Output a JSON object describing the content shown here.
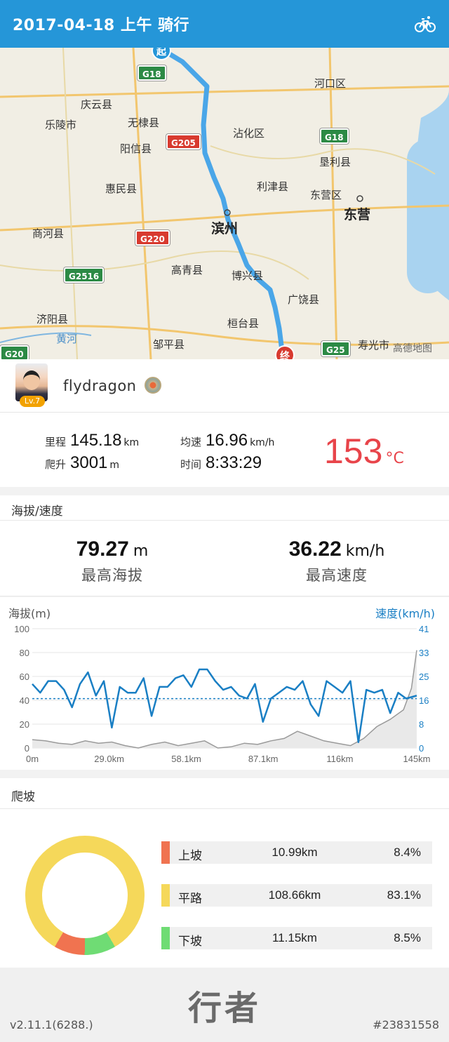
{
  "header": {
    "title": "2017-04-18 上午  骑行",
    "icon": "bicycle-icon"
  },
  "map": {
    "labels": [
      "河口区",
      "庆云县",
      "乐陵市",
      "无棣县",
      "沾化区",
      "阳信县",
      "垦利县",
      "惠民县",
      "利津县",
      "东营区",
      "东营",
      "滨州",
      "商河县",
      "高青县",
      "博兴县",
      "广饶县",
      "济阳县",
      "桓台县",
      "黄河",
      "邹平县",
      "寿光市",
      "高德地图",
      "起",
      "终"
    ],
    "shields": [
      "G18",
      "G205",
      "G18",
      "G220",
      "G2516",
      "G25",
      "G20"
    ]
  },
  "user": {
    "name": "flydragon",
    "level": "Lv.7"
  },
  "stats": {
    "distance": {
      "label": "里程",
      "value": "145.18",
      "unit": "km"
    },
    "avg_speed": {
      "label": "均速",
      "value": "16.96",
      "unit": "km/h"
    },
    "climb": {
      "label": "爬升",
      "value": "3001",
      "unit": "m"
    },
    "time": {
      "label": "时间",
      "value": "8:33:29"
    },
    "temperature": {
      "value": "153",
      "unit": "°C"
    }
  },
  "elevation_section": {
    "title": "海拔/速度"
  },
  "maxes": {
    "max_alt": {
      "value": "79.27",
      "unit": "m",
      "label": "最高海拔"
    },
    "max_speed": {
      "value": "36.22",
      "unit": "km/h",
      "label": "最高速度"
    }
  },
  "chart_data": {
    "type": "line",
    "left_axis_title": "海拔(m)",
    "right_axis_title": "速度(km/h)",
    "left_ticks": [
      "100",
      "80",
      "60",
      "40",
      "20",
      "0"
    ],
    "right_ticks": [
      "41",
      "33",
      "25",
      "16",
      "8",
      "0"
    ],
    "x_ticks": [
      "0m",
      "29.0km",
      "58.1km",
      "87.1km",
      "116km",
      "145km"
    ],
    "ylim_left": [
      0,
      100
    ],
    "ylim_right": [
      0,
      41
    ],
    "xlim": [
      0,
      145
    ],
    "avg_speed_line": 16.96,
    "colors": {
      "speed": "#1a7fc4",
      "altitude": "#9a9a9a",
      "avg": "#1a7fc4"
    },
    "series": [
      {
        "name": "速度(km/h)",
        "axis": "right",
        "x": [
          0,
          3,
          6,
          9,
          12,
          15,
          18,
          21,
          24,
          27,
          30,
          33,
          36,
          39,
          42,
          45,
          48,
          51,
          54,
          57,
          60,
          63,
          66,
          69,
          72,
          75,
          78,
          81,
          84,
          87,
          90,
          93,
          96,
          99,
          102,
          105,
          108,
          111,
          114,
          117,
          120,
          123,
          126,
          129,
          132,
          135,
          138,
          141,
          145
        ],
        "values": [
          22,
          19,
          23,
          23,
          20,
          14,
          22,
          26,
          18,
          23,
          7,
          21,
          19,
          19,
          24,
          11,
          21,
          21,
          24,
          25,
          21,
          27,
          27,
          23,
          20,
          21,
          18,
          17,
          22,
          9,
          17,
          19,
          21,
          20,
          23,
          15,
          11,
          23,
          21,
          19,
          23,
          2,
          20,
          19,
          20,
          12,
          19,
          17,
          18
        ]
      },
      {
        "name": "海拔(m)",
        "axis": "left",
        "x": [
          0,
          5,
          10,
          15,
          20,
          25,
          30,
          35,
          40,
          45,
          50,
          55,
          60,
          65,
          70,
          75,
          80,
          85,
          90,
          95,
          100,
          105,
          110,
          115,
          120,
          125,
          130,
          135,
          140,
          143,
          145
        ],
        "values": [
          7,
          6,
          4,
          3,
          6,
          4,
          5,
          2,
          0,
          3,
          5,
          2,
          4,
          6,
          0,
          1,
          4,
          3,
          6,
          8,
          14,
          10,
          6,
          4,
          2,
          8,
          18,
          24,
          32,
          50,
          82
        ]
      }
    ]
  },
  "climb_section": {
    "title": "爬坡",
    "rows": [
      {
        "name": "上坡",
        "distance": "10.99km",
        "percent": "8.4%",
        "share": 8.4,
        "color": "#f07350"
      },
      {
        "name": "平路",
        "distance": "108.66km",
        "percent": "83.1%",
        "share": 83.1,
        "color": "#f5d85a"
      },
      {
        "name": "下坡",
        "distance": "11.15km",
        "percent": "8.5%",
        "share": 8.5,
        "color": "#6fdc74"
      }
    ]
  },
  "footer": {
    "logo": "行者",
    "version": "v2.11.1(6288.)",
    "id": "#23831558"
  }
}
